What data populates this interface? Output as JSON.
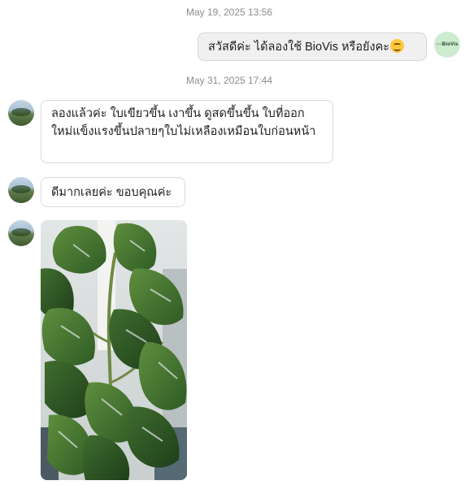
{
  "chat": {
    "timestamp_1": "May 19, 2025 13:56",
    "outgoing_message": "สวัสดีค่ะ ได้ลองใช้ BioVis หรือยังคะ",
    "outgoing_emoji": "smiling-face-emoji",
    "brand_avatar_text": "○○BioVis",
    "timestamp_2": "May 31, 2025 17:44",
    "incoming_message_1": "ลองแล้วค่ะ ใบเขียวขึ้น เงาขึ้น ดูสดขึ้นขึ้น ใบที่ออกใหม่แข็งแรงขึ้นปลายๆใบไม่เหลืองเหมือนใบก่อนหน้า",
    "incoming_message_2": "ดีมากเลยค่ะ ขอบคุณค่ะ",
    "incoming_photo": "monstera-plant-photo"
  },
  "colors": {
    "outgoing_bubble": "#f0f0f0",
    "incoming_bubble_border": "#d9d9d9",
    "timestamp_text": "#8a8d91",
    "brand_avatar_bg": "#cdeccf"
  }
}
